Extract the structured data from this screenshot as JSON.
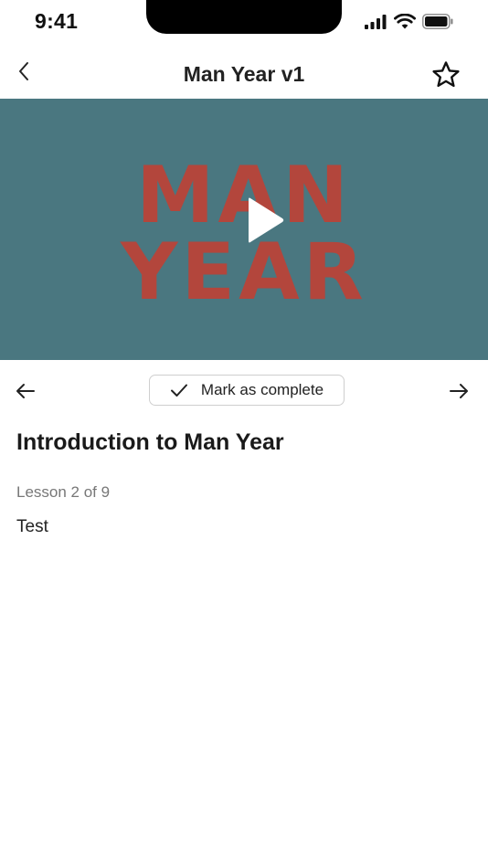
{
  "status": {
    "time": "9:41"
  },
  "nav": {
    "title": "Man Year v1",
    "back_icon": "chevron-left-icon",
    "favorite_icon": "star-outline-icon"
  },
  "video": {
    "thumbnail_line1": "MAN",
    "thumbnail_line2": "YEAR",
    "background": "#4a7780",
    "text_color": "#b3463c",
    "play_icon": "play-icon"
  },
  "lesson_nav": {
    "complete_label": "Mark as complete",
    "prev_icon": "arrow-left-icon",
    "next_icon": "arrow-right-icon",
    "check_icon": "checkmark-icon"
  },
  "lesson": {
    "title": "Introduction to Man Year",
    "count": "Lesson 2 of 9",
    "body": "Test"
  }
}
